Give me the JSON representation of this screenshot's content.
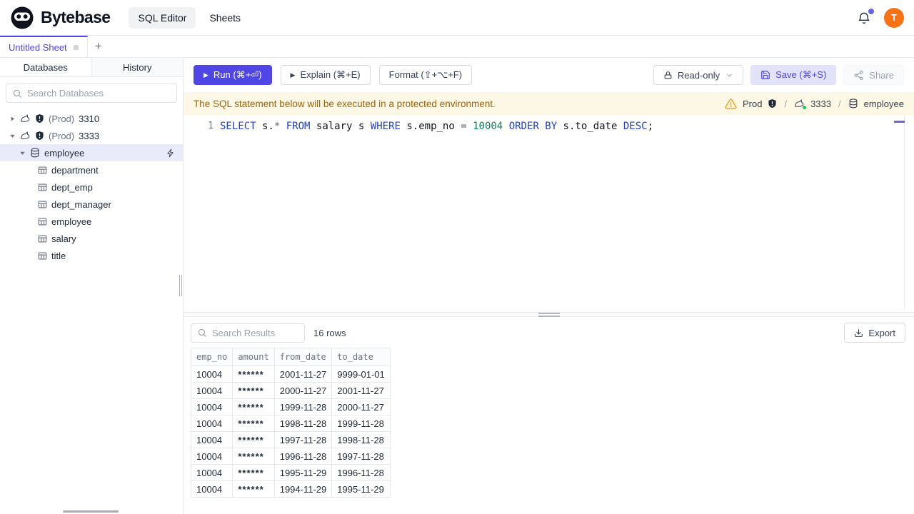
{
  "colors": {
    "accent": "#4f46e5",
    "avatar_orange": "#f97316",
    "warning_bg": "#fcf8e5",
    "warning_text": "#a16207",
    "status_green": "#22c55e",
    "keyword_blue": "#2041cc",
    "number_green": "#098658",
    "selected_row_bg": "#e9ebfb"
  },
  "header": {
    "brand": "Bytebase",
    "nav": [
      {
        "label": "SQL Editor",
        "active": true
      },
      {
        "label": "Sheets",
        "active": false
      }
    ],
    "avatar_initial": "T"
  },
  "tabbar": {
    "active_tab": "Untitled Sheet",
    "new_tab": "+"
  },
  "sidebar": {
    "tabs": [
      {
        "label": "Databases",
        "active": true
      },
      {
        "label": "History",
        "active": false
      }
    ],
    "search_placeholder": "Search Databases",
    "tree": [
      {
        "type": "instance",
        "env": "(Prod)",
        "name": "3310",
        "expanded": false
      },
      {
        "type": "instance",
        "env": "(Prod)",
        "name": "3333",
        "expanded": true
      },
      {
        "type": "database",
        "name": "employee",
        "selected": true,
        "expanded": true
      },
      {
        "type": "table",
        "name": "department"
      },
      {
        "type": "table",
        "name": "dept_emp"
      },
      {
        "type": "table",
        "name": "dept_manager"
      },
      {
        "type": "table",
        "name": "employee"
      },
      {
        "type": "table",
        "name": "salary"
      },
      {
        "type": "table",
        "name": "title"
      }
    ]
  },
  "toolbar": {
    "run": "Run (⌘+⏎)",
    "explain": "Explain (⌘+E)",
    "format": "Format (⇧+⌥+F)",
    "readonly": "Read-only",
    "save": "Save (⌘+S)",
    "share": "Share"
  },
  "banner": {
    "message": "The SQL statement below will be executed in a protected environment.",
    "environment": "Prod",
    "instance": "3333",
    "database": "employee",
    "separator": "/"
  },
  "editor": {
    "line_number": "1",
    "sql": "SELECT s.* FROM salary s WHERE s.emp_no = 10004 ORDER BY s.to_date DESC;",
    "tokens": [
      {
        "text": "SELECT",
        "type": "keyword"
      },
      {
        "text": " s.",
        "type": "plain"
      },
      {
        "text": "*",
        "type": "operator"
      },
      {
        "text": " ",
        "type": "plain"
      },
      {
        "text": "FROM",
        "type": "keyword"
      },
      {
        "text": " salary s ",
        "type": "plain"
      },
      {
        "text": "WHERE",
        "type": "keyword"
      },
      {
        "text": " s.emp_no ",
        "type": "plain"
      },
      {
        "text": "=",
        "type": "operator"
      },
      {
        "text": " ",
        "type": "plain"
      },
      {
        "text": "10004",
        "type": "number"
      },
      {
        "text": " ",
        "type": "plain"
      },
      {
        "text": "ORDER BY",
        "type": "keyword"
      },
      {
        "text": " s.to_date ",
        "type": "plain"
      },
      {
        "text": "DESC",
        "type": "keyword"
      },
      {
        "text": ";",
        "type": "plain"
      }
    ]
  },
  "results": {
    "search_placeholder": "Search Results",
    "row_count": "16 rows",
    "export": "Export",
    "table": {
      "columns": [
        "emp_no",
        "amount",
        "from_date",
        "to_date"
      ],
      "masked_column": "amount",
      "rows": [
        [
          "10004",
          "******",
          "2001-11-27",
          "9999-01-01"
        ],
        [
          "10004",
          "******",
          "2000-11-27",
          "2001-11-27"
        ],
        [
          "10004",
          "******",
          "1999-11-28",
          "2000-11-27"
        ],
        [
          "10004",
          "******",
          "1998-11-28",
          "1999-11-28"
        ],
        [
          "10004",
          "******",
          "1997-11-28",
          "1998-11-28"
        ],
        [
          "10004",
          "******",
          "1996-11-28",
          "1997-11-28"
        ],
        [
          "10004",
          "******",
          "1995-11-29",
          "1996-11-28"
        ],
        [
          "10004",
          "******",
          "1994-11-29",
          "1995-11-29"
        ]
      ]
    }
  }
}
